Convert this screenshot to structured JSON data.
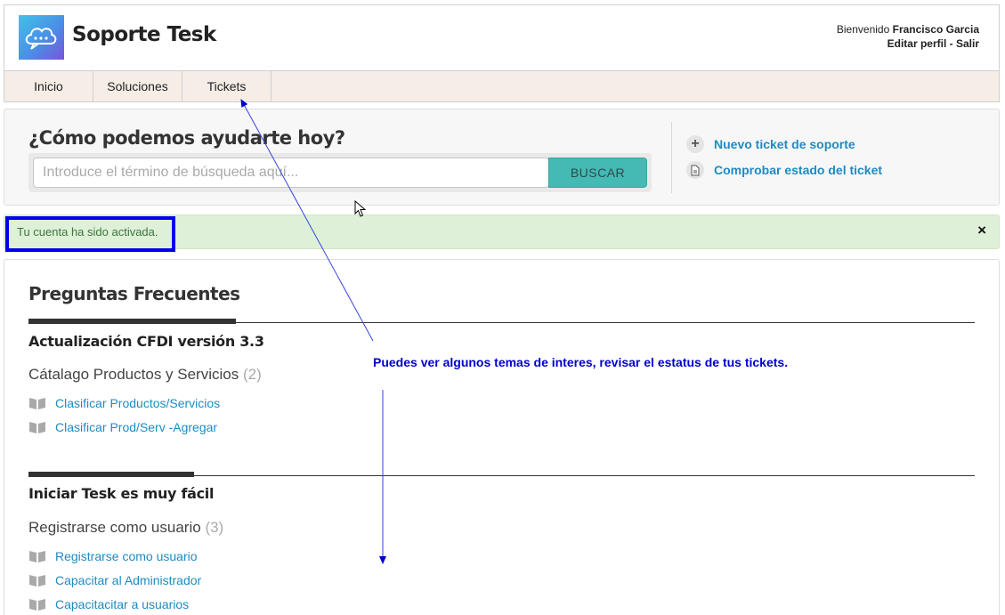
{
  "header": {
    "brand": "Soporte Tesk",
    "welcome_prefix": "Bienvenido",
    "user_name": "Francisco Garcia",
    "edit_profile": "Editar perfil",
    "separator": " - ",
    "logout": "Salir"
  },
  "nav": {
    "items": [
      {
        "label": "Inicio"
      },
      {
        "label": "Soluciones"
      },
      {
        "label": "Tickets"
      }
    ]
  },
  "search": {
    "title": "¿Cómo podemos ayudarte hoy?",
    "placeholder": "Introduce el término de búsqueda aquí...",
    "button": "BUSCAR"
  },
  "actions": {
    "new_ticket": "Nuevo ticket de soporte",
    "check_status": "Comprobar estado del ticket",
    "new_ticket_icon": "plus-icon",
    "check_status_icon": "document-icon"
  },
  "alert": {
    "text": "Tu cuenta ha sido activada.",
    "close": "×"
  },
  "faq": {
    "title": "Preguntas Frecuentes",
    "sections": [
      {
        "title": "Actualización CFDI versión 3.3",
        "category": "Cátalago Productos y Servicios",
        "count": "(2)",
        "articles": [
          "Clasificar Productos/Servicios",
          "Clasificar Prod/Serv -Agregar"
        ]
      },
      {
        "title": "Iniciar Tesk es muy fácil",
        "category": "Registrarse como usuario",
        "count": "(3)",
        "articles": [
          "Registrarse como usuario",
          "Capacitar al Administrador",
          "Capacitacitar a usuarios"
        ]
      }
    ]
  },
  "annotation": {
    "text": "Puedes ver algunos temas de interes, revisar el estatus de tus tickets."
  },
  "colors": {
    "link": "#1e8bc3",
    "button": "#45b9b4",
    "alert_bg": "#dff0d8",
    "annotation": "#0000cc",
    "nav_bg": "#f5ede6"
  }
}
